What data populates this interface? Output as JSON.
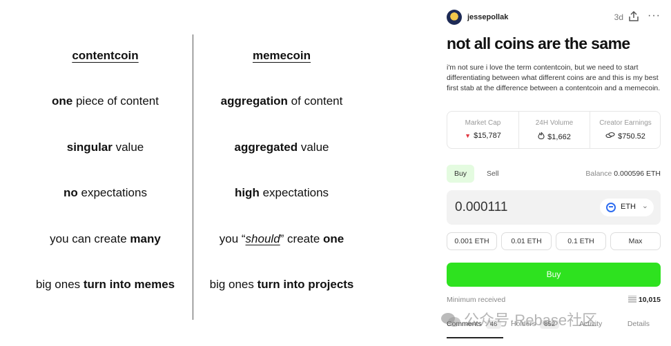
{
  "comparison": {
    "left": {
      "header": "contentcoin",
      "rows": [
        {
          "pre": "",
          "bold": "one",
          "post": " piece of content"
        },
        {
          "pre": "",
          "bold": "singular",
          "post": " value"
        },
        {
          "pre": "",
          "bold": "no",
          "post": " expectations"
        },
        {
          "pre": "you can create ",
          "bold": "many",
          "post": ""
        },
        {
          "pre": "big ones ",
          "bold": "turn into memes",
          "post": ""
        }
      ]
    },
    "right": {
      "header": "memecoin",
      "rows": [
        {
          "pre": "",
          "bold": "aggregation",
          "post": " of content"
        },
        {
          "pre": "",
          "bold": "aggregated",
          "post": " value"
        },
        {
          "pre": "",
          "bold": "high",
          "post": " expectations"
        },
        {
          "pre": "you “",
          "italic": "should",
          "mid": "” create ",
          "bold": "one"
        },
        {
          "pre": "big ones ",
          "bold": "turn into projects",
          "post": ""
        }
      ]
    }
  },
  "post": {
    "username": "jessepollak",
    "age": "3d",
    "more_label": "···",
    "title": "not all coins are the same",
    "body": "i'm not sure i love the term contentcoin, but we need to start differentiating between what different coins are and this is my best first stab at the difference between a contentcoin and a memecoin."
  },
  "stats": [
    {
      "label": "Market Cap",
      "icon": "▼",
      "value": "$15,787"
    },
    {
      "label": "24H Volume",
      "icon": "flame-icon",
      "value": "$1,662"
    },
    {
      "label": "Creator Earnings",
      "icon": "coins-icon",
      "value": "$750.52"
    }
  ],
  "trade": {
    "buy_tab": "Buy",
    "sell_tab": "Sell",
    "balance_label": "Balance",
    "balance_value": "0.000596 ETH",
    "amount": "0.000111",
    "coin": "ETH",
    "presets": [
      "0.001 ETH",
      "0.01 ETH",
      "0.1 ETH",
      "Max"
    ],
    "buy_button": "Buy",
    "min_label": "Minimum received",
    "min_value": "10,015"
  },
  "bottom_tabs": [
    {
      "label": "Comments",
      "count": "46"
    },
    {
      "label": "Holders",
      "count": "852"
    },
    {
      "label": "Activity",
      "count": ""
    },
    {
      "label": "Details",
      "count": ""
    }
  ],
  "watermark": "公众号·Rebase社区",
  "colors": {
    "buy_green": "#2ee21f",
    "buy_tab_bg": "#e4fbe0",
    "down_red": "#e0353e",
    "eth_blue": "#2d6cf0"
  }
}
